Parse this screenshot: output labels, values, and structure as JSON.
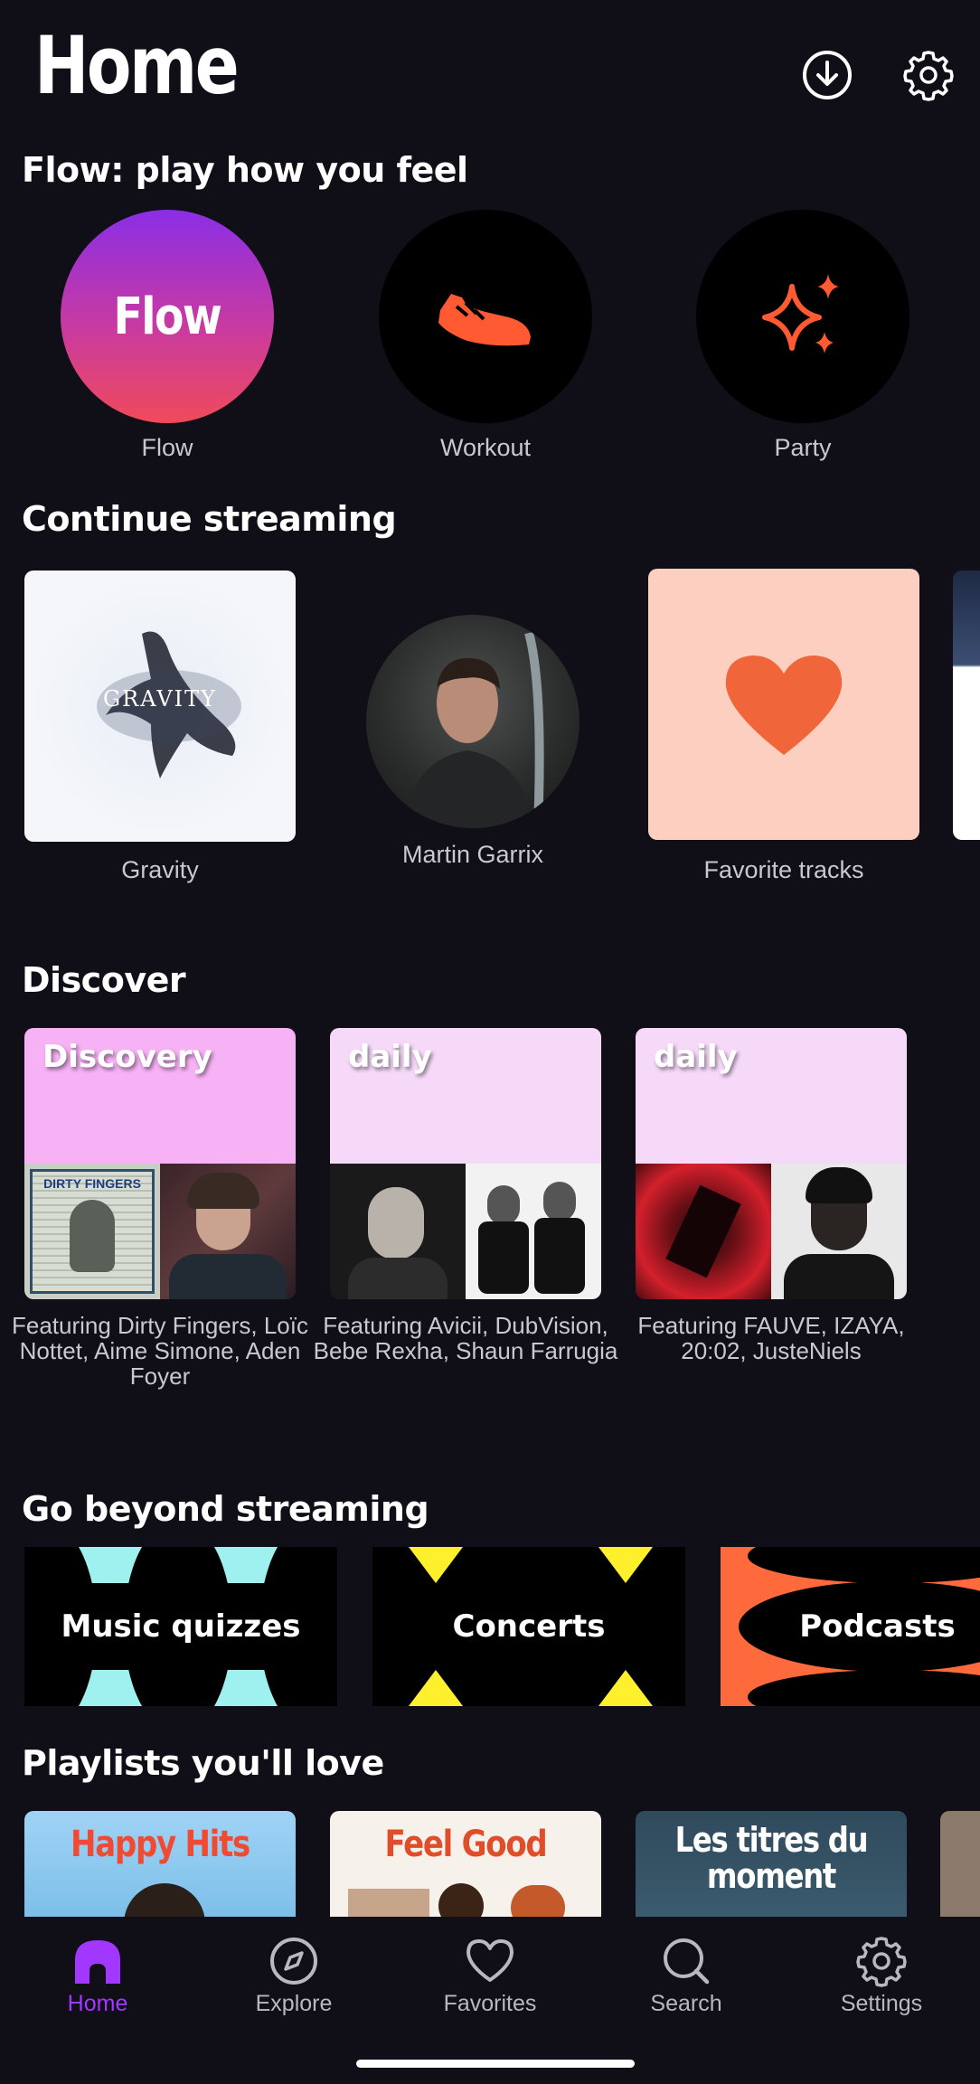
{
  "header": {
    "title": "Home",
    "download_icon": "download-icon",
    "settings_icon": "gear-icon"
  },
  "flow_section": {
    "title": "Flow: play how you feel",
    "items": [
      {
        "label": "Flow",
        "badge": "Flow"
      },
      {
        "label": "Workout",
        "icon": "sneaker-icon"
      },
      {
        "label": "Party",
        "icon": "sparkle-icon"
      }
    ]
  },
  "continue_section": {
    "title": "Continue streaming",
    "items": [
      {
        "label": "Gravity",
        "cover_text": "GRAVITY"
      },
      {
        "label": "Martin Garrix"
      },
      {
        "label": "Favorite tracks",
        "icon": "heart-icon"
      }
    ]
  },
  "discover_section": {
    "title": "Discover",
    "cards": [
      {
        "tag": "Discovery",
        "caption": "Featuring Dirty Fingers, Loïc Nottet, Aime Simone, Aden Foyer",
        "mini_text": "DIRTY FINGERS"
      },
      {
        "tag": "daily",
        "caption": "Featuring Avicii, DubVision, Bebe Rexha, Shaun Farrugia"
      },
      {
        "tag": "daily",
        "caption": "Featuring FAUVE, IZAYA, 20:02, JusteNiels"
      }
    ]
  },
  "beyond_section": {
    "title": "Go beyond streaming",
    "items": [
      {
        "label": "Music quizzes"
      },
      {
        "label": "Concerts"
      },
      {
        "label": "Podcasts"
      }
    ]
  },
  "playlists_section": {
    "title": "Playlists you'll love",
    "items": [
      {
        "title": "Happy Hits"
      },
      {
        "title": "Feel Good"
      },
      {
        "title": "Les titres du moment"
      }
    ]
  },
  "nav": {
    "items": [
      {
        "label": "Home",
        "icon": "home-icon",
        "active": true
      },
      {
        "label": "Explore",
        "icon": "compass-icon"
      },
      {
        "label": "Favorites",
        "icon": "heart-icon"
      },
      {
        "label": "Search",
        "icon": "search-icon"
      },
      {
        "label": "Settings",
        "icon": "gear-icon"
      }
    ]
  },
  "colors": {
    "background": "#100e17",
    "accent": "#a238ff",
    "orange": "#ff5a32",
    "discover_pink": "#f7b2f5",
    "daily_pink": "#f6d9f9",
    "favorites_peach": "#fccfc1"
  }
}
